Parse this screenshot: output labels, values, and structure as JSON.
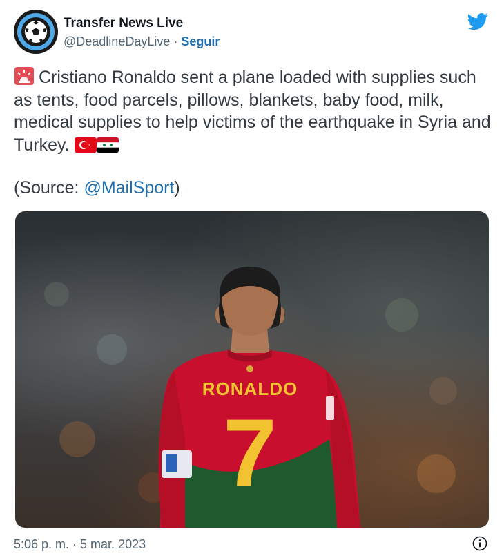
{
  "account": {
    "name": "Transfer News Live",
    "handle": "@DeadlineDayLive",
    "separator": "·",
    "follow_label": "Seguir"
  },
  "tweet": {
    "text": "Cristiano Ronaldo sent a plane loaded with supplies such as tents, food parcels, pillows, blankets, baby food, milk, medical supplies to help victims of the earthquake in Syria and Turkey.",
    "source_prefix": "(Source: ",
    "source_mention": "@MailSport",
    "source_suffix": ")",
    "lead_icon": "rotating-light-emoji",
    "flags": [
      "turkey-flag-emoji",
      "syria-flag-emoji"
    ]
  },
  "media": {
    "jersey_name": "RONALDO",
    "jersey_number": "7"
  },
  "footer": {
    "timestamp": "5:06 p. m. · 5 mar. 2023"
  },
  "colors": {
    "brand_blue": "#1d9bf0",
    "link_blue": "#1d6fb1",
    "secondary_text": "#536471"
  }
}
